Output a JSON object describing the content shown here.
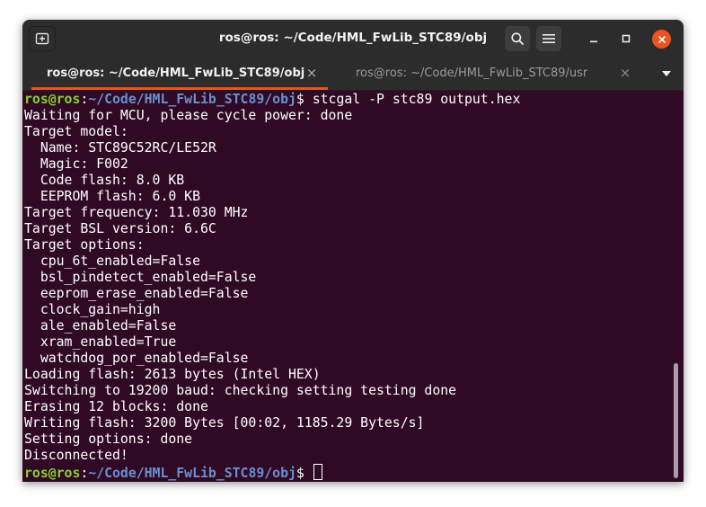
{
  "window": {
    "title": "ros@ros: ~/Code/HML_FwLib_STC89/obj"
  },
  "titlebar": {
    "new_tab_icon": "new-tab-icon",
    "search_icon": "search-icon",
    "menu_icon": "hamburger-menu-icon",
    "minimize_icon": "minimize-icon",
    "maximize_icon": "maximize-icon",
    "close_icon": "close-icon"
  },
  "tabs": [
    {
      "label": "ros@ros: ~/Code/HML_FwLib_STC89/obj",
      "active": true,
      "close": "×"
    },
    {
      "label": "ros@ros: ~/Code/HML_FwLib_STC89/usr",
      "active": false,
      "close": "×"
    }
  ],
  "colors": {
    "terminal_bg": "#300a24",
    "titlebar_bg": "#2c2c2c",
    "accent": "#e95420",
    "prompt_user": "#87d22a",
    "prompt_path": "#6a8fcf"
  },
  "prompt": {
    "user": "ros@ros",
    "colon": ":",
    "path": "~/Code/HML_FwLib_STC89/obj",
    "dollar": "$ "
  },
  "command": "stcgal -P stc89 output.hex",
  "output": [
    "Waiting for MCU, please cycle power: done",
    "Target model:",
    "  Name: STC89C52RC/LE52R",
    "  Magic: F002",
    "  Code flash: 8.0 KB",
    "  EEPROM flash: 6.0 KB",
    "Target frequency: 11.030 MHz",
    "Target BSL version: 6.6C",
    "Target options:",
    "  cpu_6t_enabled=False",
    "  bsl_pindetect_enabled=False",
    "  eeprom_erase_enabled=False",
    "  clock_gain=high",
    "  ale_enabled=False",
    "  xram_enabled=True",
    "  watchdog_por_enabled=False",
    "Loading flash: 2613 bytes (Intel HEX)",
    "Switching to 19200 baud: checking setting testing done",
    "Erasing 12 blocks: done",
    "Writing flash: 3200 Bytes [00:02, 1185.29 Bytes/s]",
    "Setting options: done",
    "Disconnected!"
  ],
  "scrollbar": {
    "position_fraction": 1.0,
    "visible_fraction": 0.3
  }
}
